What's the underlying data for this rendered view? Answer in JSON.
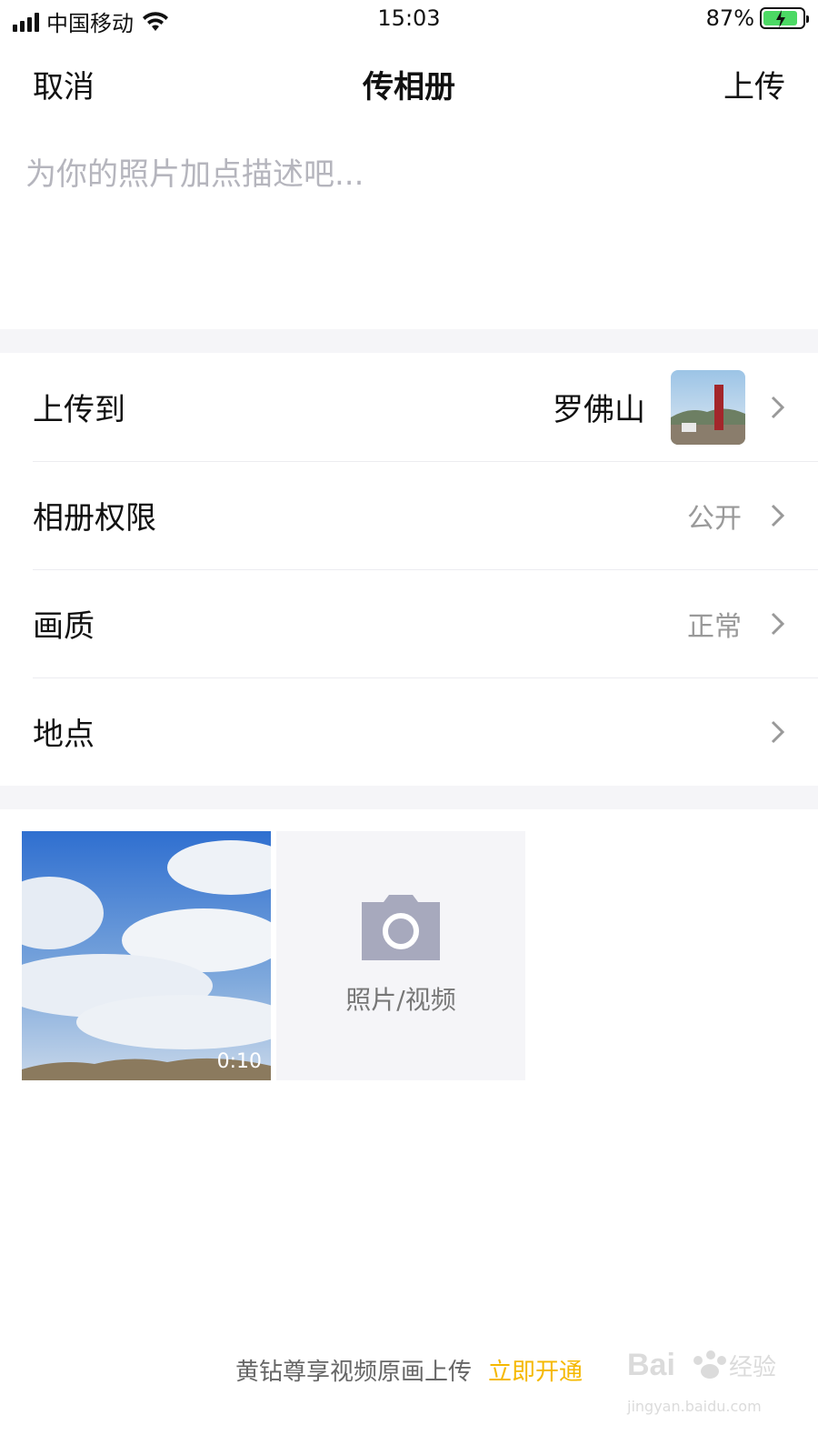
{
  "status_bar": {
    "carrier": "中国移动",
    "time": "15:03",
    "battery_percent": "87%",
    "battery_level": 0.87,
    "battery_color": "#4cd964"
  },
  "nav": {
    "cancel_label": "取消",
    "title": "传相册",
    "upload_label": "上传"
  },
  "description": {
    "placeholder": "为你的照片加点描述吧...",
    "value": ""
  },
  "settings": [
    {
      "label": "上传到",
      "value": "罗佛山"
    },
    {
      "label": "相册权限",
      "value": "公开"
    },
    {
      "label": "画质",
      "value": "正常"
    },
    {
      "label": "地点",
      "value": ""
    }
  ],
  "media": {
    "video_duration": "0:10",
    "add_label": "照片/视频",
    "add_icon": "camera-icon"
  },
  "footer": {
    "text": "黄钻尊享视频原画上传",
    "link_label": "立即开通",
    "link_color": "#f5b800"
  },
  "watermark": {
    "logo": "Baidu经验",
    "url": "jingyan.baidu.com"
  }
}
